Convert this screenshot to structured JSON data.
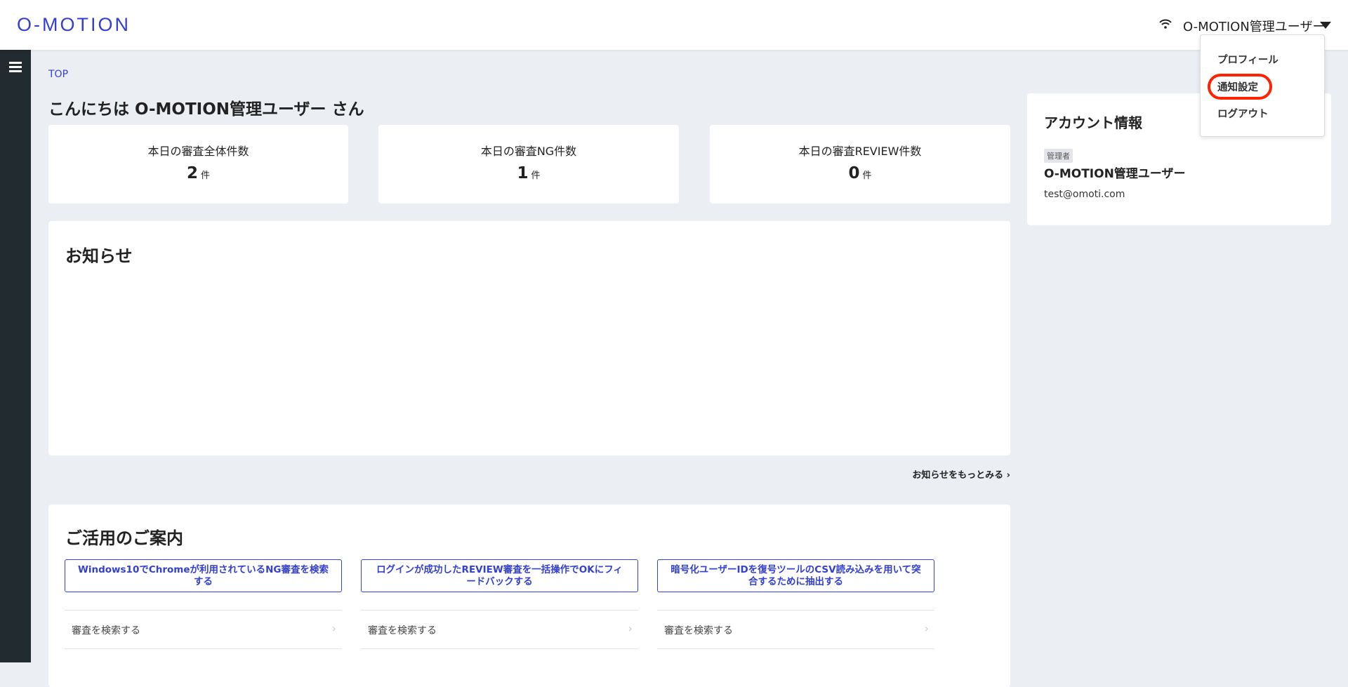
{
  "header": {
    "logo": "O-MOTION",
    "user_name": "O-MOTION管理ユーザー"
  },
  "user_menu": {
    "items": [
      "プロフィール",
      "通知設定",
      "ログアウト"
    ],
    "highlighted": "通知設定"
  },
  "breadcrumb": "TOP",
  "greeting": "こんにちは O-MOTION管理ユーザー さん",
  "stats": [
    {
      "title": "本日の審査全体件数",
      "value": "2",
      "unit": "件"
    },
    {
      "title": "本日の審査NG件数",
      "value": "1",
      "unit": "件"
    },
    {
      "title": "本日の審査REVIEW件数",
      "value": "0",
      "unit": "件"
    }
  ],
  "news": {
    "title": "お知らせ",
    "more_link": "お知らせをもっとみる ›"
  },
  "guide": {
    "title": "ご活用のご案内",
    "buttons": [
      "Windows10でChromeが利用されているNG審査を検索する",
      "ログインが成功したREVIEW審査を一括操作でOKにフィードバックする",
      "暗号化ユーザーIDを復号ツールのCSV読み込みを用いて突合するために抽出する"
    ],
    "links": [
      "審査を検索する",
      "審査を検索する",
      "審査を検索する"
    ]
  },
  "account": {
    "title": "アカウント情報",
    "role": "管理者",
    "name": "O-MOTION管理ユーザー",
    "email": "test@omoti.com"
  },
  "colors": {
    "brand": "#3340d0",
    "sidebar": "#222b30",
    "highlight": "#ff2200"
  }
}
